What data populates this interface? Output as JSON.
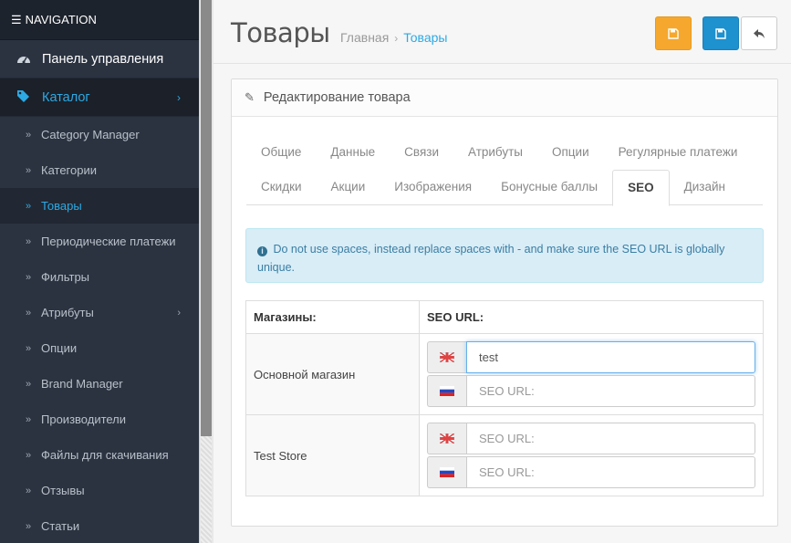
{
  "sidebar": {
    "header": "NAVIGATION",
    "top_items": [
      {
        "label": "Панель управления",
        "icon": "dashboard-icon"
      },
      {
        "label": "Каталог",
        "icon": "tag-icon",
        "active": true
      }
    ],
    "sub_items": [
      {
        "label": "Category Manager"
      },
      {
        "label": "Категории"
      },
      {
        "label": "Товары",
        "active": true
      },
      {
        "label": "Периодические платежи"
      },
      {
        "label": "Фильтры"
      },
      {
        "label": "Атрибуты",
        "has_children": true
      },
      {
        "label": "Опции"
      },
      {
        "label": "Brand Manager"
      },
      {
        "label": "Производители"
      },
      {
        "label": "Файлы для скачивания"
      },
      {
        "label": "Отзывы"
      },
      {
        "label": "Статьи"
      }
    ]
  },
  "header": {
    "title": "Товары",
    "breadcrumb": [
      "Главная",
      "Товары"
    ]
  },
  "panel": {
    "heading": "Редактирование товара",
    "tabs_row1": [
      "Общие",
      "Данные",
      "Связи",
      "Атрибуты",
      "Опции",
      "Регулярные платежи"
    ],
    "tabs_row2": [
      "Скидки",
      "Акции",
      "Изображения",
      "Бонусные баллы",
      "SEO",
      "Дизайн"
    ],
    "active_tab": "SEO",
    "alert": "Do not use spaces, instead replace spaces with - and make sure the SEO URL is globally unique.",
    "table": {
      "col_store": "Магазины:",
      "col_url": "SEO URL:",
      "rows": [
        {
          "store": "Основной магазин",
          "inputs": [
            {
              "lang": "en-gb",
              "value": "test",
              "placeholder": "SEO URL:"
            },
            {
              "lang": "ru-ru",
              "value": "",
              "placeholder": "SEO URL:"
            }
          ]
        },
        {
          "store": "Test Store",
          "inputs": [
            {
              "lang": "en-gb",
              "value": "",
              "placeholder": "SEO URL:"
            },
            {
              "lang": "ru-ru",
              "value": "",
              "placeholder": "SEO URL:"
            }
          ]
        }
      ]
    }
  },
  "colors": {
    "accent": "#2da9e3",
    "sidebar_bg": "#2b3341",
    "btn_orange": "#f5a82d",
    "btn_blue": "#1e91cf"
  }
}
